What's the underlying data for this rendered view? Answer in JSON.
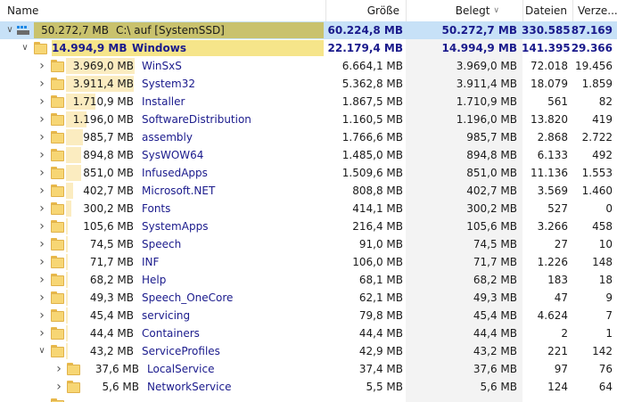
{
  "header": {
    "name": "Name",
    "groesse": "Größe",
    "belegt": "Belegt",
    "dateien": "Dateien",
    "verzeichnisse": "Verze..."
  },
  "root": {
    "size": "50.272,7 MB",
    "name": "C:\\ auf  [SystemSSD]",
    "groesse": "60.224,8 MB",
    "belegt": "50.272,7 MB",
    "dateien": "330.585",
    "verz": "87.169"
  },
  "windows": {
    "size": "14.994,9 MB",
    "name": "Windows",
    "groesse": "22.179,4 MB",
    "belegt": "14.994,9 MB",
    "dateien": "141.395",
    "verz": "29.366"
  },
  "folders": [
    {
      "size": "3.969,0 MB",
      "name": "WinSxS",
      "groesse": "6.664,1 MB",
      "belegt": "3.969,0 MB",
      "dateien": "72.018",
      "verz": "19.456",
      "share": 0.265
    },
    {
      "size": "3.911,4 MB",
      "name": "System32",
      "groesse": "5.362,8 MB",
      "belegt": "3.911,4 MB",
      "dateien": "18.079",
      "verz": "1.859",
      "share": 0.261
    },
    {
      "size": "1.710,9 MB",
      "name": "Installer",
      "groesse": "1.867,5 MB",
      "belegt": "1.710,9 MB",
      "dateien": "561",
      "verz": "82",
      "share": 0.114
    },
    {
      "size": "1.196,0 MB",
      "name": "SoftwareDistribution",
      "groesse": "1.160,5 MB",
      "belegt": "1.196,0 MB",
      "dateien": "13.820",
      "verz": "419",
      "share": 0.08
    },
    {
      "size": "985,7 MB",
      "name": "assembly",
      "groesse": "1.766,6 MB",
      "belegt": "985,7 MB",
      "dateien": "2.868",
      "verz": "2.722",
      "share": 0.066
    },
    {
      "size": "894,8 MB",
      "name": "SysWOW64",
      "groesse": "1.485,0 MB",
      "belegt": "894,8 MB",
      "dateien": "6.133",
      "verz": "492",
      "share": 0.06
    },
    {
      "size": "851,0 MB",
      "name": "InfusedApps",
      "groesse": "1.509,6 MB",
      "belegt": "851,0 MB",
      "dateien": "11.136",
      "verz": "1.553",
      "share": 0.057
    },
    {
      "size": "402,7 MB",
      "name": "Microsoft.NET",
      "groesse": "808,8 MB",
      "belegt": "402,7 MB",
      "dateien": "3.569",
      "verz": "1.460",
      "share": 0.027
    },
    {
      "size": "300,2 MB",
      "name": "Fonts",
      "groesse": "414,1 MB",
      "belegt": "300,2 MB",
      "dateien": "527",
      "verz": "0",
      "share": 0.02
    },
    {
      "size": "105,6 MB",
      "name": "SystemApps",
      "groesse": "216,4 MB",
      "belegt": "105,6 MB",
      "dateien": "3.266",
      "verz": "458",
      "share": 0.007
    },
    {
      "size": "74,5 MB",
      "name": "Speech",
      "groesse": "91,0 MB",
      "belegt": "74,5 MB",
      "dateien": "27",
      "verz": "10",
      "share": 0.005
    },
    {
      "size": "71,7 MB",
      "name": "INF",
      "groesse": "106,0 MB",
      "belegt": "71,7 MB",
      "dateien": "1.226",
      "verz": "148",
      "share": 0.005
    },
    {
      "size": "68,2 MB",
      "name": "Help",
      "groesse": "68,1 MB",
      "belegt": "68,2 MB",
      "dateien": "183",
      "verz": "18",
      "share": 0.005
    },
    {
      "size": "49,3 MB",
      "name": "Speech_OneCore",
      "groesse": "62,1 MB",
      "belegt": "49,3 MB",
      "dateien": "47",
      "verz": "9",
      "share": 0.003
    },
    {
      "size": "45,4 MB",
      "name": "servicing",
      "groesse": "79,8 MB",
      "belegt": "45,4 MB",
      "dateien": "4.624",
      "verz": "7",
      "share": 0.003
    },
    {
      "size": "44,4 MB",
      "name": "Containers",
      "groesse": "44,4 MB",
      "belegt": "44,4 MB",
      "dateien": "2",
      "verz": "1",
      "share": 0.003
    },
    {
      "size": "43,2 MB",
      "name": "ServiceProfiles",
      "groesse": "42,9 MB",
      "belegt": "43,2 MB",
      "dateien": "221",
      "verz": "142",
      "share": 0.003,
      "expanded": true
    }
  ],
  "subfolders": [
    {
      "size": "37,6 MB",
      "name": "LocalService",
      "groesse": "37,4 MB",
      "belegt": "37,6 MB",
      "dateien": "97",
      "verz": "76"
    },
    {
      "size": "5,6 MB",
      "name": "NetworkService",
      "groesse": "5,5 MB",
      "belegt": "5,6 MB",
      "dateien": "124",
      "verz": "64"
    }
  ],
  "colors": {
    "root_bar": "#c9c26d",
    "windows_bar": "#f6e58a",
    "folder_bar": "#fbecc0",
    "selection": "#c7e1f7",
    "name_text": "#1a1a8c"
  }
}
